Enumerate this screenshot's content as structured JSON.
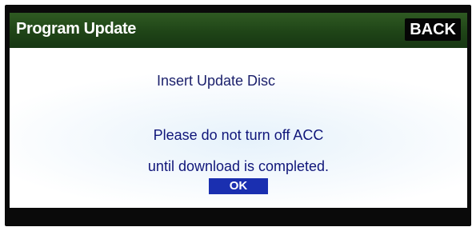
{
  "window": {
    "title": "Program Update"
  },
  "toolbar": {
    "back_label": "BACK"
  },
  "dialog": {
    "instruction": "Insert Update Disc",
    "warning_line1": "Please do not turn off ACC",
    "warning_line2": "until download is completed.",
    "ok_label": "OK"
  },
  "colors": {
    "titlebar": "#1f4417",
    "ok_button": "#1a2fb0",
    "message_text": "#10167a",
    "bezel": "#0a0a0a"
  }
}
